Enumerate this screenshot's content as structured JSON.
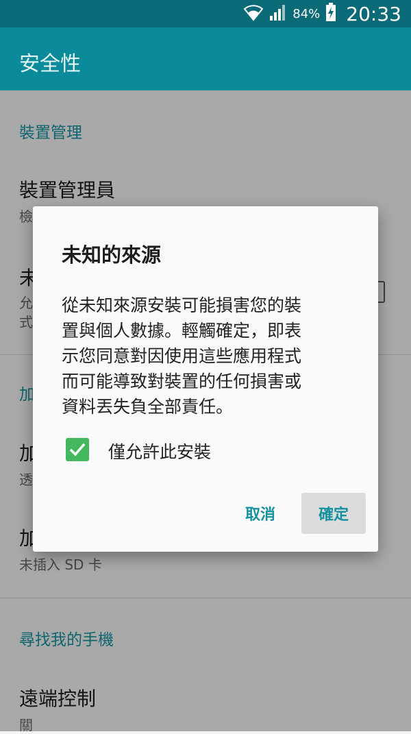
{
  "status_bar": {
    "battery": "84%",
    "time": "20:33"
  },
  "app_bar": {
    "title": "安全性"
  },
  "background_list": {
    "section1_header": "裝置管理",
    "item1_title": "裝置管理員",
    "item1_sub": "檢",
    "item2_title": "未",
    "item2_sub_line1": "允",
    "item2_sub_line2": "式",
    "section2_header": "加",
    "item3_title": "加",
    "item3_sub": "透",
    "item4_title": "加",
    "item4_sub": "未插入 SD 卡",
    "section3_header": "尋找我的手機",
    "item5_title": "遠端控制",
    "item5_sub": "關"
  },
  "dialog": {
    "title": "未知的來源",
    "body_lines": [
      "從未知來源安裝可能損害您的裝",
      "置與個人數據。輕觸確定，即表",
      "示您同意對因使用這些應用程式",
      "而可能導致對裝置的任何損害或",
      "資料丟失負全部責任。"
    ],
    "checkbox_label": "僅允許此安裝",
    "checkbox_checked": true,
    "cancel_label": "取消",
    "ok_label": "確定"
  },
  "colors": {
    "status_bar": "#0b6a78",
    "app_bar": "#0b8a99",
    "accent": "#1591a0",
    "checkbox": "#43b85f"
  }
}
